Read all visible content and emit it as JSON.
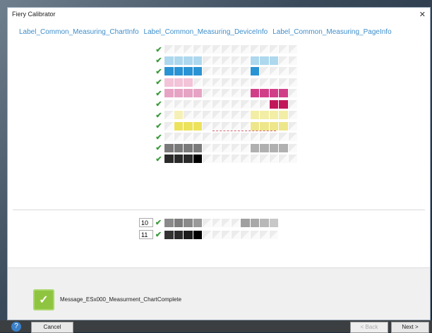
{
  "window": {
    "title": "Fiery Calibrator"
  },
  "links": [
    "Label_Common_Measuring_ChartInfo",
    "Label_Common_Measuring_DeviceInfo",
    "Label_Common_Measuring_PageInfo"
  ],
  "chart_rows": [
    {
      "measured": true,
      "cells": [
        "e",
        "e",
        "e",
        "e",
        "e",
        "e",
        "e",
        "e",
        "e",
        "e",
        "e",
        "e",
        "e",
        "e"
      ]
    },
    {
      "measured": true,
      "cells": [
        "#aed8ee",
        "#aed8ee",
        "#aed8ee",
        "#aed8ee",
        "e",
        "e",
        "e",
        "e",
        "e",
        "#aed8ee",
        "#aed8ee",
        "#aed8ee",
        "e",
        "e"
      ]
    },
    {
      "measured": true,
      "cells": [
        "#2a93d3",
        "#2a93d3",
        "#2a93d3",
        "#2a93d3",
        "e",
        "e",
        "e",
        "e",
        "e",
        "#2a93d3",
        "e",
        "e",
        "e",
        "e"
      ]
    },
    {
      "measured": true,
      "cells": [
        "#f3c3d8",
        "#f3c3d8",
        "#f3c3d8",
        "e",
        "e",
        "e",
        "e",
        "e",
        "e",
        "e",
        "e",
        "e",
        "e",
        "e"
      ]
    },
    {
      "measured": true,
      "cells": [
        "#e6a3c4",
        "#e6a3c4",
        "#e6a3c4",
        "#e6a3c4",
        "e",
        "e",
        "e",
        "e",
        "e",
        "#d13e88",
        "#d13e88",
        "#d13e88",
        "#d13e88",
        "e"
      ]
    },
    {
      "measured": true,
      "cells": [
        "e",
        "e",
        "e",
        "e",
        "e",
        "e",
        "e",
        "e",
        "e",
        "e",
        "e",
        "#c2185b",
        "#c2185b",
        "e"
      ]
    },
    {
      "measured": true,
      "cells": [
        "e",
        "#f5f0b5",
        "e",
        "e",
        "e",
        "e",
        "e",
        "e",
        "e",
        "#f3eea5",
        "#f3eea5",
        "#f3eea5",
        "#f3eea5",
        "e"
      ]
    },
    {
      "measured": true,
      "cells": [
        "e",
        "#ece25c",
        "#ece25c",
        "#ece25c",
        "e",
        "e",
        "e",
        "e",
        "e",
        "#eee68a",
        "#eee68a",
        "#eee68a",
        "#eee68a",
        "e"
      ]
    },
    {
      "measured": true,
      "cells": [
        "e",
        "e",
        "e",
        "e",
        "e",
        "e",
        "e",
        "e",
        "e",
        "e",
        "e",
        "e",
        "e",
        "e"
      ]
    },
    {
      "measured": true,
      "cells": [
        "#7a7a7a",
        "#7a7a7a",
        "#7a7a7a",
        "#7a7a7a",
        "e",
        "e",
        "e",
        "e",
        "e",
        "#b0b0b0",
        "#b0b0b0",
        "#b0b0b0",
        "#b0b0b0",
        "e"
      ]
    },
    {
      "measured": true,
      "cells": [
        "#2a2a2a",
        "#2a2a2a",
        "#2a2a2a",
        "#000000",
        "e",
        "e",
        "e",
        "e",
        "e",
        "e",
        "e",
        "e",
        "e",
        "e"
      ]
    }
  ],
  "mini_rows": [
    {
      "number": "10",
      "measured": true,
      "cells": [
        "#8a8a8a",
        "#7d7d7d",
        "#8a8a8a",
        "#9a9a9a",
        "e",
        "e",
        "e",
        "e",
        "#a0a0a0",
        "#a8a8a8",
        "#b8b8b8",
        "#c8c8c8"
      ]
    },
    {
      "number": "11",
      "measured": true,
      "cells": [
        "#333333",
        "#2a2a2a",
        "#1c1c1c",
        "#000000",
        "e",
        "e",
        "e",
        "e",
        "e",
        "e",
        "e",
        "e"
      ]
    }
  ],
  "status": {
    "message": "Message_ESx000_Measurment_ChartComplete",
    "icon": "check-icon",
    "accent": "#8fc440"
  },
  "buttons": {
    "help": "?",
    "cancel": "Cancel",
    "back": "< Back",
    "next": "Next >"
  }
}
